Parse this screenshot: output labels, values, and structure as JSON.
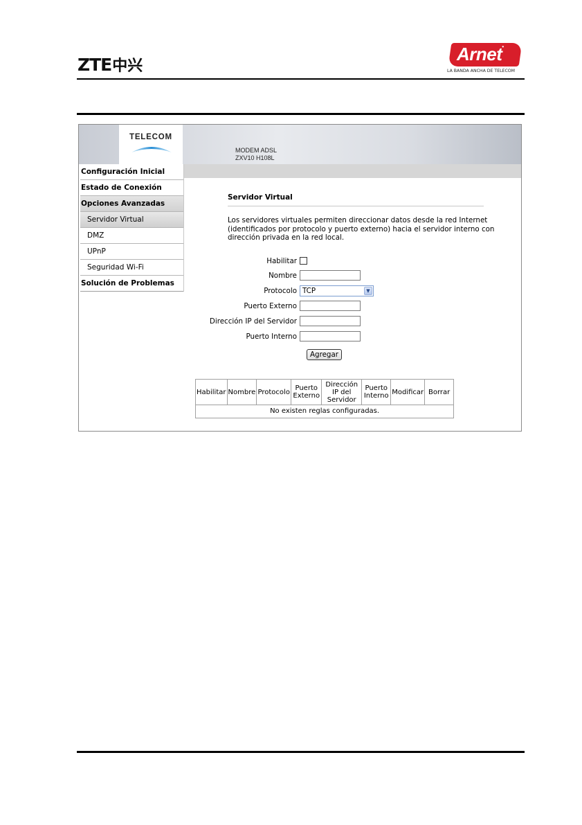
{
  "doc_header": {
    "zte_latin": "ZTE",
    "zte_chinese": "中兴",
    "arnet_word": "Arnet",
    "arnet_tagline": "LA BANDA ANCHA DE TELECOM"
  },
  "banner": {
    "brand": "TELECOM",
    "model_line1": "MODEM ADSL",
    "model_line2": "ZXV10 H108L"
  },
  "nav": {
    "items": [
      {
        "label": "Configuración Inicial"
      },
      {
        "label": "Estado de Conexión"
      },
      {
        "label": "Opciones Avanzadas"
      },
      {
        "label": "Servidor Virtual"
      },
      {
        "label": "DMZ"
      },
      {
        "label": "UPnP"
      },
      {
        "label": "Seguridad Wi-Fi"
      },
      {
        "label": "Solución de Problemas"
      }
    ]
  },
  "content": {
    "title": "Servidor Virtual",
    "description": "Los servidores virtuales permiten direccionar datos desde la red Internet (identificados por protocolo y puerto externo) hacia el servidor interno con dirección privada en la red local."
  },
  "form": {
    "enable_label": "Habilitar",
    "name_label": "Nombre",
    "name_value": "",
    "protocol_label": "Protocolo",
    "protocol_value": "TCP",
    "ext_port_label": "Puerto Externo",
    "ext_port_value": "",
    "server_ip_label": "Dirección IP del Servidor",
    "server_ip_value": "",
    "int_port_label": "Puerto Interno",
    "int_port_value": "",
    "add_button": "Agregar"
  },
  "rules_table": {
    "headers": {
      "enable": "Habilitar",
      "name": "Nombre",
      "protocol": "Protocolo",
      "ext_port_1": "Puerto",
      "ext_port_2": "Externo",
      "ip_1": "Dirección",
      "ip_2": "IP del",
      "ip_3": "Servidor",
      "int_port_1": "Puerto",
      "int_port_2": "Interno",
      "modify": "Modificar",
      "delete": "Borrar"
    },
    "empty_message": "No existen reglas configuradas."
  },
  "colors": {
    "arnet_red": "#d81e2a",
    "telecom_arc": "#2a8fd6",
    "select_border": "#7a9ccf"
  }
}
